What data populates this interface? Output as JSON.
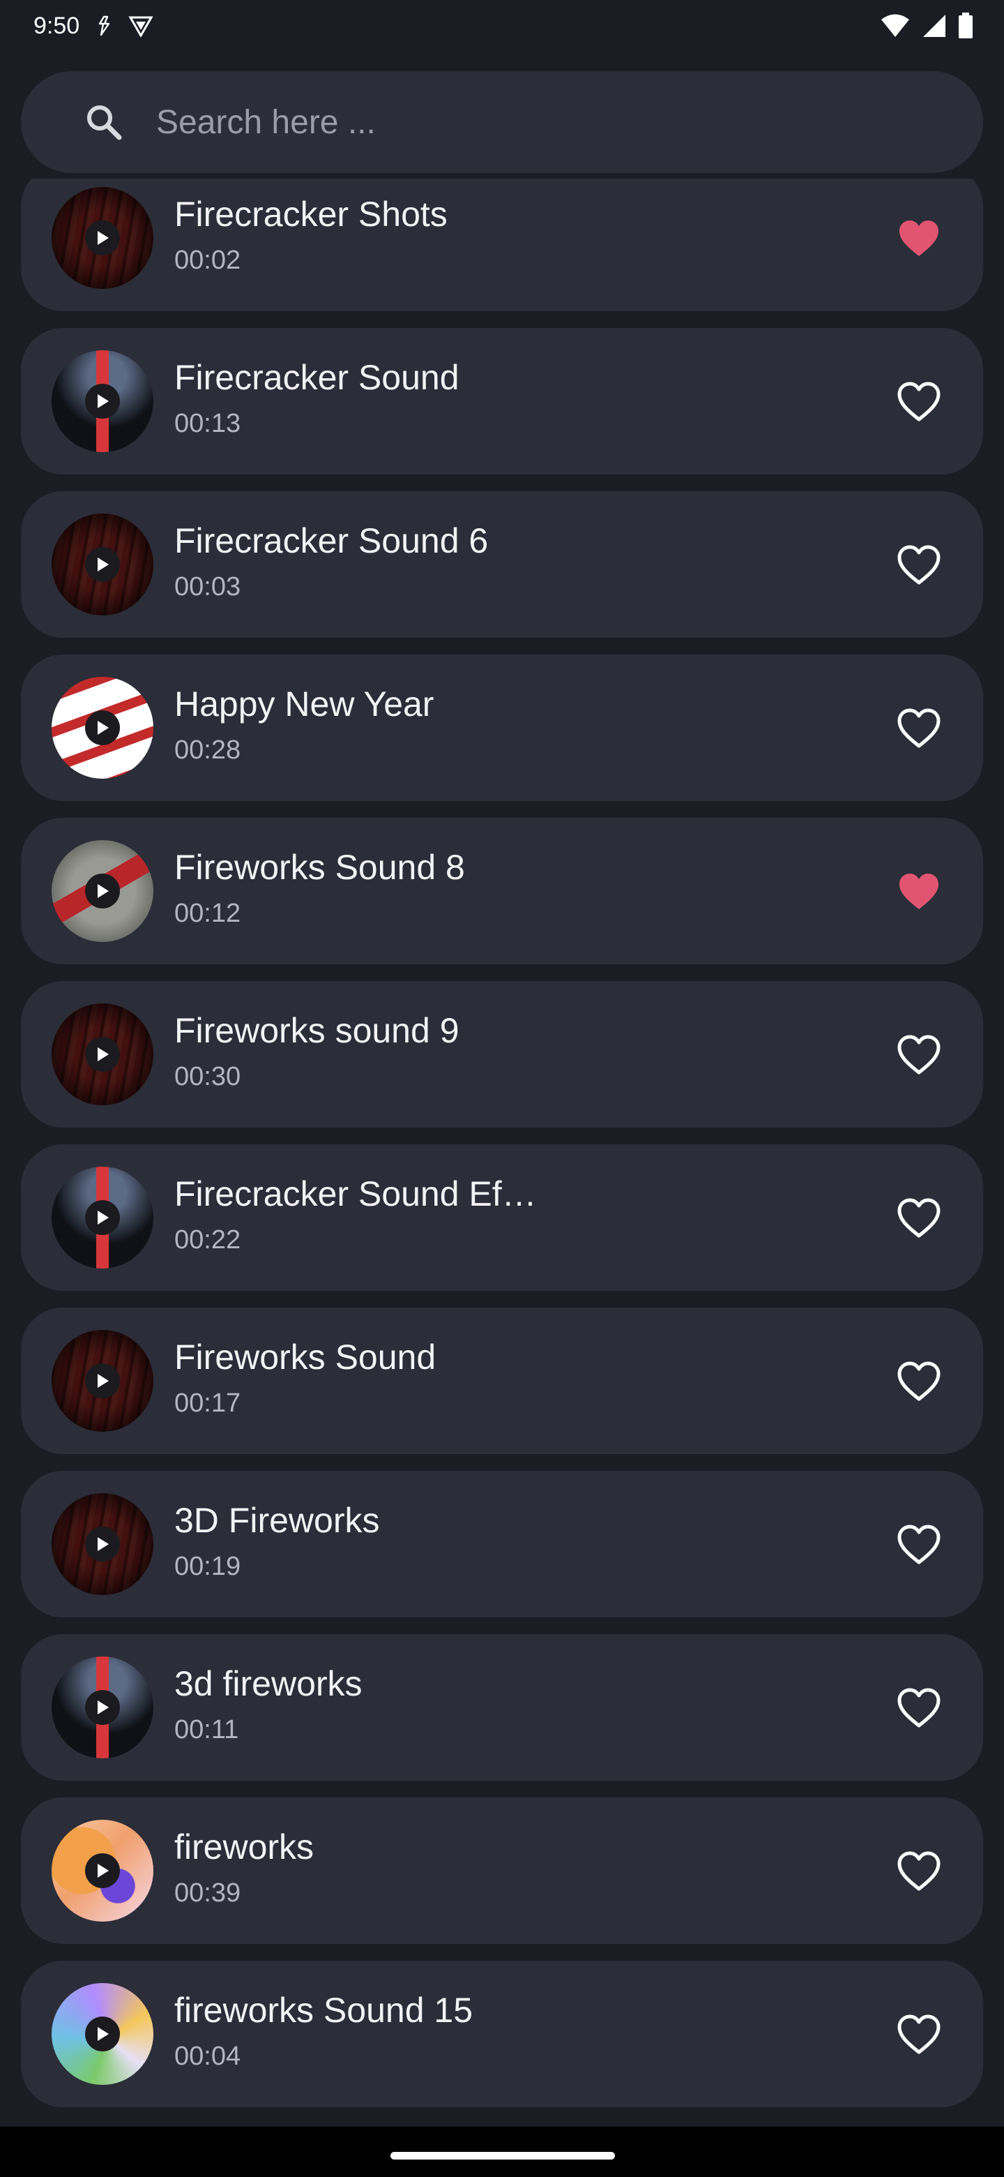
{
  "status_bar": {
    "time": "9:50"
  },
  "search": {
    "placeholder": "Search here ..."
  },
  "colors": {
    "background": "#1b1c24",
    "card": "#2b2d38",
    "favorite_active": "#e25572",
    "favorite_inactive": "#ffffff"
  },
  "items": [
    {
      "title": "Firecracker Shots",
      "duration": "00:02",
      "favorite": true,
      "art": "red"
    },
    {
      "title": "Firecracker Sound",
      "duration": "00:13",
      "favorite": false,
      "art": "dark"
    },
    {
      "title": "Firecracker Sound 6",
      "duration": "00:03",
      "favorite": false,
      "art": "red"
    },
    {
      "title": "Happy New Year",
      "duration": "00:28",
      "favorite": false,
      "art": "paper"
    },
    {
      "title": "Fireworks Sound 8",
      "duration": "00:12",
      "favorite": true,
      "art": "grey"
    },
    {
      "title": "Fireworks sound 9",
      "duration": "00:30",
      "favorite": false,
      "art": "red"
    },
    {
      "title": "Firecracker Sound Ef…",
      "duration": "00:22",
      "favorite": false,
      "art": "dark"
    },
    {
      "title": "Fireworks Sound",
      "duration": "00:17",
      "favorite": false,
      "art": "red"
    },
    {
      "title": "3D Fireworks",
      "duration": "00:19",
      "favorite": false,
      "art": "red"
    },
    {
      "title": "3d fireworks",
      "duration": "00:11",
      "favorite": false,
      "art": "dark"
    },
    {
      "title": "fireworks",
      "duration": "00:39",
      "favorite": false,
      "art": "orange"
    },
    {
      "title": "fireworks Sound 15",
      "duration": "00:04",
      "favorite": false,
      "art": "multi"
    }
  ]
}
